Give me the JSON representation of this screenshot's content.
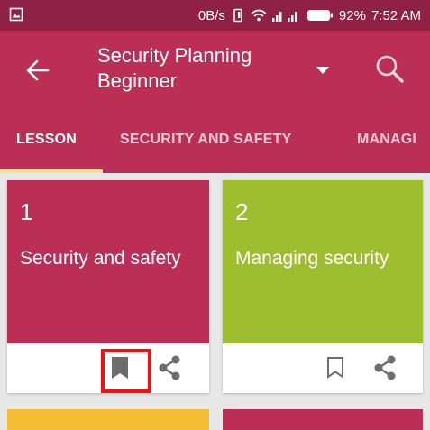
{
  "status": {
    "speed": "0B/s",
    "battery": "92%",
    "time": "7:52 AM"
  },
  "header": {
    "title": "Security Planning Beginner"
  },
  "tabs": [
    {
      "label": "LESSON",
      "active": true
    },
    {
      "label": "SECURITY AND SAFETY",
      "active": false
    },
    {
      "label": "MANAGI",
      "active": false
    }
  ],
  "cards": [
    {
      "number": "1",
      "title": "Security and safety",
      "color": "#bb2f57",
      "bookmarked": true
    },
    {
      "number": "2",
      "title": "Managing security",
      "color": "#9fbe2f",
      "bookmarked": false
    }
  ],
  "colors": {
    "status_bar": "#8e2145",
    "primary": "#bb2f57",
    "card_yellow": "#f2bd33",
    "card_red": "#bb2f57"
  }
}
